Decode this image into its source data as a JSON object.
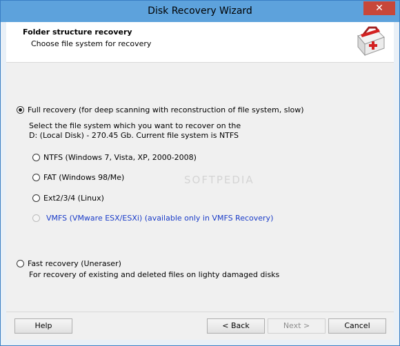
{
  "window": {
    "title": "Disk Recovery Wizard",
    "close_glyph": "✕"
  },
  "header": {
    "title": "Folder structure recovery",
    "subtitle": "Choose file system for recovery",
    "logo_icon": "first-aid-kit-icon"
  },
  "options": {
    "full": {
      "label": "Full recovery (for deep scanning with reconstruction of file system, slow)",
      "selected": true
    },
    "description_line1": "Select the file system which you want to recover on the",
    "description_line2": "D: (Local Disk) - 270.45 Gb. Current file system is NTFS",
    "filesystems": [
      {
        "label": "NTFS (Windows 7, Vista, XP, 2000-2008)",
        "enabled": true
      },
      {
        "label": "FAT (Windows 98/Me)",
        "enabled": true
      },
      {
        "label": "Ext2/3/4 (Linux)",
        "enabled": true
      },
      {
        "label": "VMFS (VMware ESX/ESXi) (available only in VMFS Recovery)",
        "enabled": false
      }
    ],
    "fast": {
      "label": "Fast recovery (Uneraser)",
      "selected": false
    },
    "fast_description": "For recovery of existing and deleted files on lighty damaged disks"
  },
  "watermark": "SOFTPEDIA",
  "buttons": {
    "help": "Help",
    "back": "< Back",
    "next": "Next >",
    "cancel": "Cancel"
  }
}
